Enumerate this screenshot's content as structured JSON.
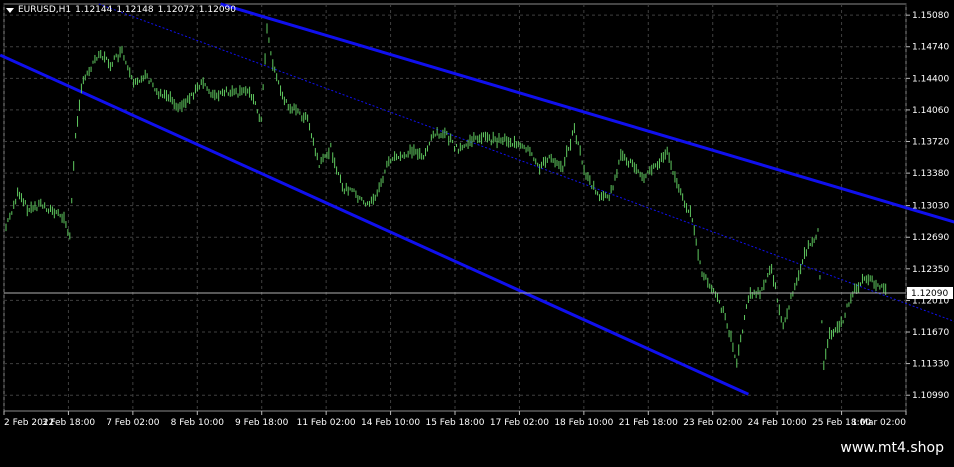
{
  "header": {
    "symbol": "EURUSD,H1",
    "open": "1.12144",
    "high": "1.12148",
    "low": "1.12072",
    "close": "1.12090"
  },
  "watermark": "www.mt4.shop",
  "colors": {
    "background": "#000000",
    "candles": "#5fc95f",
    "channel": "#1010ee",
    "grid": "#3f3f3f",
    "axis_text": "#ffffff",
    "bid_line": "#b0b0b0"
  },
  "chart_data": {
    "type": "line",
    "title": "",
    "xlabel": "",
    "ylabel": "",
    "ylim": [
      1.1082,
      1.152
    ],
    "x_ticks": [
      "2 Feb 2022",
      "3 Feb 18:00",
      "7 Feb 02:00",
      "8 Feb 10:00",
      "9 Feb 18:00",
      "11 Feb 02:00",
      "14 Feb 10:00",
      "15 Feb 18:00",
      "17 Feb 02:00",
      "18 Feb 10:00",
      "21 Feb 18:00",
      "23 Feb 02:00",
      "24 Feb 10:00",
      "25 Feb 18:00",
      "1 Mar 02:00"
    ],
    "y_ticks": [
      "1.15080",
      "1.14740",
      "1.14400",
      "1.14060",
      "1.13720",
      "1.13380",
      "1.13030",
      "1.12690",
      "1.12350",
      "1.12010",
      "1.11670",
      "1.11330",
      "1.10990"
    ],
    "current_price": "1.12090",
    "grid": true,
    "series": [
      {
        "values": [
          [
            0,
            1.128
          ],
          [
            1,
            1.1315
          ],
          [
            2,
            1.1298
          ],
          [
            3,
            1.1305
          ],
          [
            4,
            1.1297
          ],
          [
            5,
            1.1289
          ],
          [
            5.5,
            1.127
          ],
          [
            6,
            1.138
          ],
          [
            6.5,
            1.143
          ],
          [
            7,
            1.1445
          ],
          [
            8,
            1.1468
          ],
          [
            9,
            1.1455
          ],
          [
            10,
            1.1468
          ],
          [
            11,
            1.1432
          ],
          [
            12,
            1.1445
          ],
          [
            13,
            1.1425
          ],
          [
            14,
            1.1422
          ],
          [
            15,
            1.1408
          ],
          [
            16,
            1.1422
          ],
          [
            17,
            1.1435
          ],
          [
            18,
            1.142
          ],
          [
            19,
            1.1425
          ],
          [
            20,
            1.1423
          ],
          [
            21,
            1.1428
          ],
          [
            22,
            1.1395
          ],
          [
            22.5,
            1.1495
          ],
          [
            23,
            1.1455
          ],
          [
            24,
            1.1415
          ],
          [
            25,
            1.1405
          ],
          [
            26,
            1.1395
          ],
          [
            27,
            1.1345
          ],
          [
            28,
            1.1365
          ],
          [
            29,
            1.1322
          ],
          [
            30,
            1.1318
          ],
          [
            31,
            1.1303
          ],
          [
            32,
            1.1315
          ],
          [
            33,
            1.1352
          ],
          [
            34,
            1.1355
          ],
          [
            35,
            1.1362
          ],
          [
            36,
            1.1357
          ],
          [
            37,
            1.1382
          ],
          [
            38,
            1.1378
          ],
          [
            39,
            1.1362
          ],
          [
            40,
            1.1372
          ],
          [
            41,
            1.1378
          ],
          [
            42,
            1.1373
          ],
          [
            43,
            1.1375
          ],
          [
            44,
            1.1368
          ],
          [
            45,
            1.1362
          ],
          [
            46,
            1.1345
          ],
          [
            47,
            1.1355
          ],
          [
            48,
            1.1345
          ],
          [
            49,
            1.1385
          ],
          [
            50,
            1.1335
          ],
          [
            51,
            1.1315
          ],
          [
            52,
            1.131
          ],
          [
            53,
            1.1355
          ],
          [
            54,
            1.1348
          ],
          [
            55,
            1.1335
          ],
          [
            56,
            1.1345
          ],
          [
            57,
            1.136
          ],
          [
            58,
            1.132
          ],
          [
            59,
            1.1295
          ],
          [
            60,
            1.123
          ],
          [
            61,
            1.121
          ],
          [
            62,
            1.1185
          ],
          [
            63,
            1.1135
          ],
          [
            64,
            1.1205
          ],
          [
            65,
            1.121
          ],
          [
            66,
            1.1235
          ],
          [
            67,
            1.1172
          ],
          [
            68,
            1.1218
          ],
          [
            69,
            1.1255
          ],
          [
            70,
            1.1275
          ],
          [
            70.5,
            1.1128
          ],
          [
            71,
            1.1165
          ],
          [
            72,
            1.1175
          ],
          [
            73,
            1.121
          ],
          [
            74,
            1.1225
          ],
          [
            75,
            1.1219
          ],
          [
            76,
            1.1209
          ]
        ]
      }
    ],
    "channel_lines": [
      {
        "name": "upper",
        "from": [
          18.5,
          1.152
        ],
        "to": [
          84,
          1.1277
        ]
      },
      {
        "name": "middle",
        "from": [
          8,
          1.152
        ],
        "to": [
          84,
          1.1168
        ]
      },
      {
        "name": "lower",
        "from": [
          -0.5,
          1.1465
        ],
        "to": [
          64,
          1.11
        ]
      }
    ]
  }
}
